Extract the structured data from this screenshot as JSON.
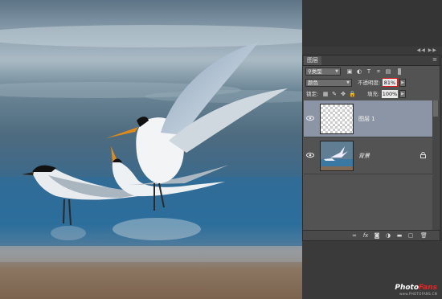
{
  "panel": {
    "tab_label": "图层",
    "menu_icon": "panel-menu-icon",
    "filter": {
      "value": "类型",
      "icons": [
        "image-filter-icon",
        "adjustment-filter-icon",
        "type-filter-icon",
        "shape-filter-icon",
        "smart-object-filter-icon"
      ]
    },
    "blend_mode": "颜色",
    "opacity_label": "不透明度:",
    "opacity_value": "81%",
    "lock_label": "锁定:",
    "fill_label": "填充:",
    "fill_value": "100%",
    "layers": [
      {
        "name": "图层 1",
        "visible": true,
        "selected": true,
        "thumbnail": "transparent-checkerboard"
      },
      {
        "name": "背景",
        "visible": true,
        "selected": false,
        "locked": true,
        "thumbnail": "birds-photo"
      }
    ],
    "footer_icons": [
      "link-layers-icon",
      "fx-icon",
      "add-mask-icon",
      "adjustment-layer-icon",
      "new-group-icon",
      "new-layer-icon",
      "delete-icon"
    ],
    "footer_fx": "fx"
  },
  "watermark": {
    "brand_a": "Photo",
    "brand_b": "Fans",
    "url": "www.PHOTOFANS.CN"
  },
  "colors": {
    "highlight": "#d91c1c",
    "selected_layer": "#8c95a6",
    "panel_bg": "#535353"
  }
}
